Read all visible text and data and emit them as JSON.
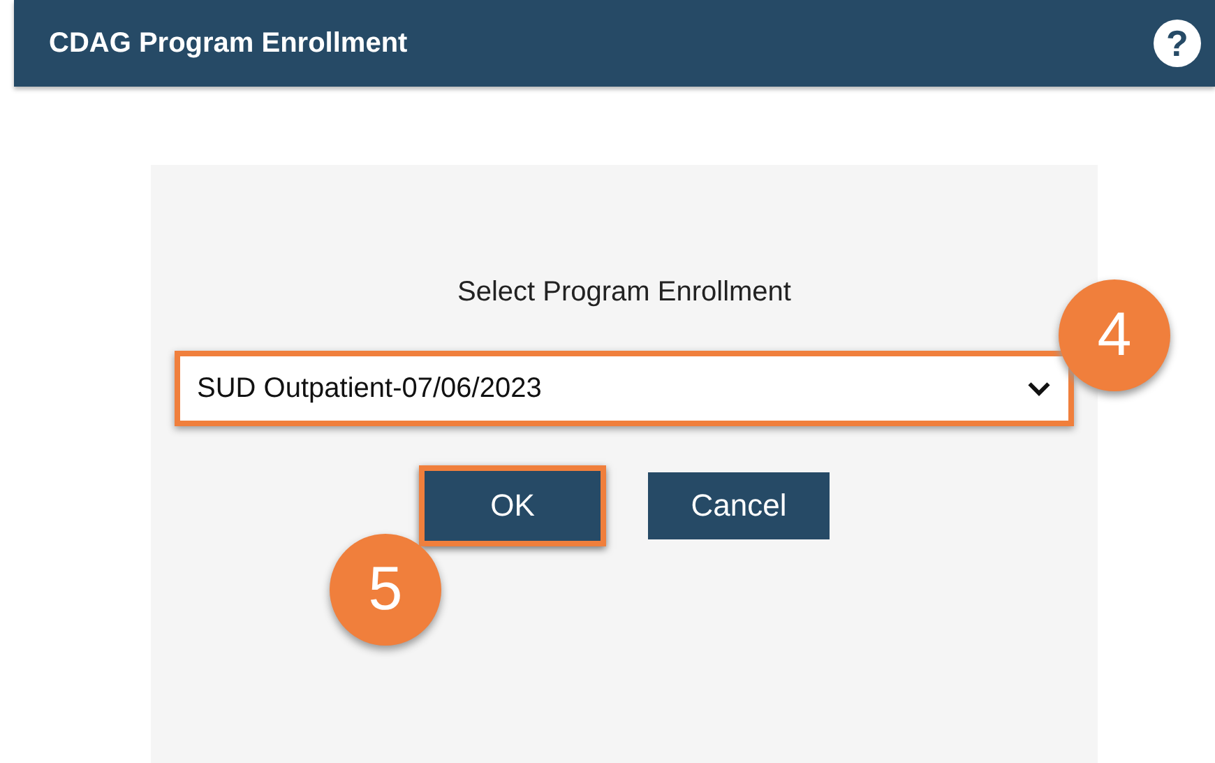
{
  "header": {
    "title": "CDAG Program Enrollment",
    "help_glyph": "?"
  },
  "dialog": {
    "label": "Select Program Enrollment",
    "select": {
      "value": "SUD Outpatient-07/06/2023",
      "highlighted": true
    },
    "buttons": [
      {
        "label": "OK",
        "highlighted": true
      },
      {
        "label": "Cancel",
        "highlighted": false
      }
    ]
  },
  "callouts": [
    {
      "number": "4",
      "kind": "upper"
    },
    {
      "number": "5",
      "kind": "lower"
    }
  ]
}
